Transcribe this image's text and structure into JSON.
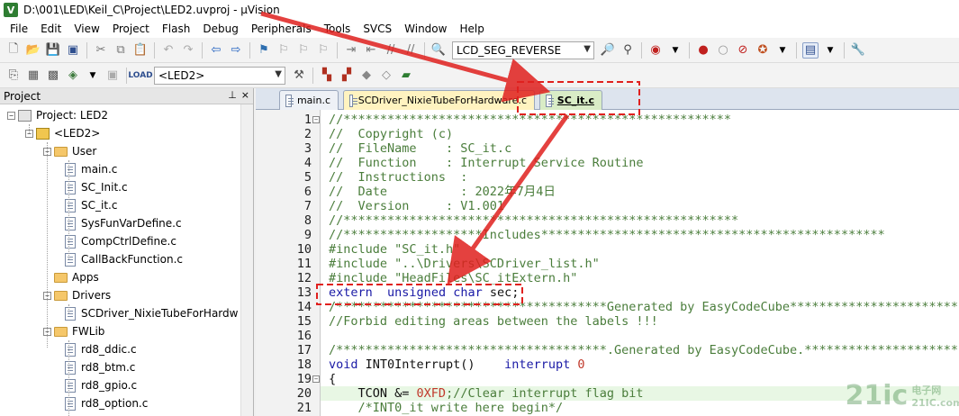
{
  "window": {
    "title": "D:\\001\\LED\\Keil_C\\Project\\LED2.uvproj - µVision",
    "icon": "uvision-app-icon"
  },
  "menu": [
    "File",
    "Edit",
    "View",
    "Project",
    "Flash",
    "Debug",
    "Peripherals",
    "Tools",
    "SVCS",
    "Window",
    "Help"
  ],
  "toolbar": {
    "find_combo": "LCD_SEG_REVERSE",
    "target_combo": "<LED2>"
  },
  "project_panel": {
    "title": "Project",
    "pin_glyph": "⊥",
    "close_glyph": "×",
    "tree": [
      {
        "label": "Project: LED2",
        "type": "project",
        "expander": "−"
      },
      {
        "label": "<LED2>",
        "type": "target",
        "expander": "−"
      },
      {
        "label": "User",
        "type": "folder",
        "expander": "−"
      },
      {
        "label": "main.c",
        "type": "file"
      },
      {
        "label": "SC_Init.c",
        "type": "file"
      },
      {
        "label": "SC_it.c",
        "type": "file"
      },
      {
        "label": "SysFunVarDefine.c",
        "type": "file"
      },
      {
        "label": "CompCtrlDefine.c",
        "type": "file"
      },
      {
        "label": "CallBackFunction.c",
        "type": "file"
      },
      {
        "label": "Apps",
        "type": "folder"
      },
      {
        "label": "Drivers",
        "type": "folder",
        "expander": "−"
      },
      {
        "label": "SCDriver_NixieTubeForHardw",
        "type": "file"
      },
      {
        "label": "FWLib",
        "type": "folder",
        "expander": "−"
      },
      {
        "label": "rd8_ddic.c",
        "type": "file"
      },
      {
        "label": "rd8_btm.c",
        "type": "file"
      },
      {
        "label": "rd8_gpio.c",
        "type": "file"
      },
      {
        "label": "rd8_option.c",
        "type": "file"
      }
    ]
  },
  "tabs": [
    {
      "label": "main.c",
      "active": false
    },
    {
      "label": "SCDriver_NixieTubeForHardware.c",
      "active": false
    },
    {
      "label": "SC_it.c",
      "active": true
    }
  ],
  "editor": {
    "current_line": 20,
    "lines": [
      {
        "n": "1",
        "fold": "−",
        "segs": [
          [
            "c",
            "//*****************************************************"
          ]
        ]
      },
      {
        "n": "2",
        "segs": [
          [
            "c",
            "//  Copyright (c)"
          ]
        ]
      },
      {
        "n": "3",
        "segs": [
          [
            "c",
            "//  FileName    : SC_it.c"
          ]
        ]
      },
      {
        "n": "4",
        "segs": [
          [
            "c",
            "//  Function    : Interrupt Service Routine"
          ]
        ]
      },
      {
        "n": "5",
        "segs": [
          [
            "c",
            "//  Instructions  :"
          ]
        ]
      },
      {
        "n": "6",
        "segs": [
          [
            "c",
            "//  Date          : 2022年7月4日"
          ]
        ]
      },
      {
        "n": "7",
        "segs": [
          [
            "c",
            "//  Version     : V1.001"
          ]
        ]
      },
      {
        "n": "8",
        "segs": [
          [
            "c",
            "//******************************************************"
          ]
        ]
      },
      {
        "n": "9",
        "segs": [
          [
            "c",
            "//*******************Includes***********************************************"
          ]
        ]
      },
      {
        "n": "10",
        "segs": [
          [
            "c",
            "#include \"SC_it.h\""
          ]
        ]
      },
      {
        "n": "11",
        "segs": [
          [
            "c",
            "#include \"..\\Drivers\\SCDriver_list.h\""
          ]
        ]
      },
      {
        "n": "12",
        "segs": [
          [
            "c",
            "#include \"HeadFiles\\SC_itExtern.h\""
          ]
        ]
      },
      {
        "n": "13",
        "segs": [
          [
            "k",
            "extern"
          ],
          [
            "p",
            "  "
          ],
          [
            "k",
            "unsigned char"
          ],
          [
            "p",
            " sec;"
          ]
        ]
      },
      {
        "n": "14",
        "segs": [
          [
            "c",
            "/*************************************Generated by EasyCodeCube***********************"
          ]
        ]
      },
      {
        "n": "15",
        "segs": [
          [
            "c",
            "//Forbid editing areas between the labels !!!"
          ]
        ]
      },
      {
        "n": "16",
        "segs": [
          [
            "p",
            ""
          ]
        ]
      },
      {
        "n": "17",
        "segs": [
          [
            "c",
            "/*************************************.Generated by EasyCodeCube.*********************"
          ]
        ]
      },
      {
        "n": "18",
        "segs": [
          [
            "k",
            "void"
          ],
          [
            "p",
            " INT0Interrupt()    "
          ],
          [
            "k",
            "interrupt"
          ],
          [
            "p",
            " "
          ],
          [
            "r",
            "0"
          ]
        ]
      },
      {
        "n": "19",
        "fold": "−",
        "segs": [
          [
            "p",
            "{"
          ]
        ]
      },
      {
        "n": "20",
        "segs": [
          [
            "p",
            "    TCON &= "
          ],
          [
            "r",
            "0XFD"
          ],
          [
            "c",
            ";//Clear interrupt flag bit"
          ]
        ]
      },
      {
        "n": "21",
        "segs": [
          [
            "c",
            "    /*INT0_it write here begin*/"
          ]
        ]
      }
    ]
  },
  "annotation_colors": {
    "highlight_box": "#e0201e",
    "arrow": "#e0201e"
  },
  "watermark": {
    "main": "21ic",
    "sub_top": "电子网",
    "sub_bottom": "21IC.com"
  }
}
